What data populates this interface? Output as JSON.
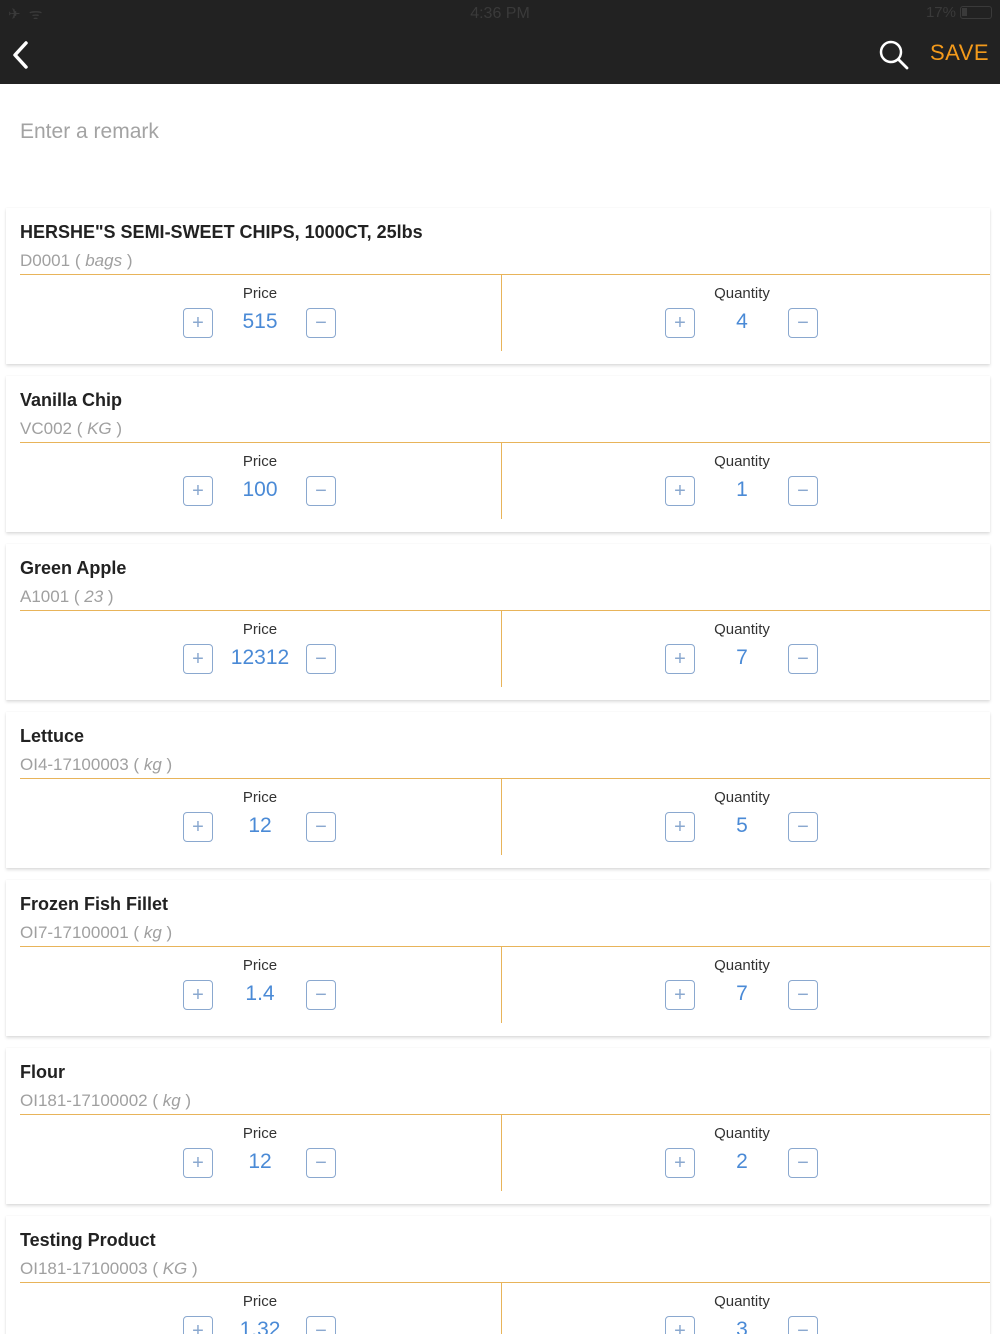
{
  "status_bar": {
    "left": "✈ ᯤ",
    "time": "4:36 PM",
    "battery": "17%"
  },
  "header": {
    "save_label": "SAVE"
  },
  "remark": {
    "placeholder": "Enter a remark"
  },
  "field_labels": {
    "price": "Price",
    "quantity": "Quantity"
  },
  "products": [
    {
      "name": "HERSHE\"S SEMI-SWEET CHIPS, 1000CT, 25lbs",
      "code": "D0001",
      "unit": "bags",
      "price": "515",
      "quantity": "4"
    },
    {
      "name": "Vanilla Chip",
      "code": "VC002",
      "unit": "KG",
      "price": "100",
      "quantity": "1"
    },
    {
      "name": "Green Apple",
      "code": "A1001",
      "unit": "23",
      "price": "12312",
      "quantity": "7"
    },
    {
      "name": "Lettuce",
      "code": "OI4-17100003",
      "unit": "kg",
      "price": "12",
      "quantity": "5"
    },
    {
      "name": "Frozen Fish Fillet",
      "code": "OI7-17100001",
      "unit": "kg",
      "price": "1.4",
      "quantity": "7"
    },
    {
      "name": "Flour",
      "code": "OI181-17100002",
      "unit": "kg",
      "price": "12",
      "quantity": "2"
    },
    {
      "name": "Testing Product",
      "code": "OI181-17100003",
      "unit": "KG",
      "price": "1.32",
      "quantity": "3"
    }
  ]
}
